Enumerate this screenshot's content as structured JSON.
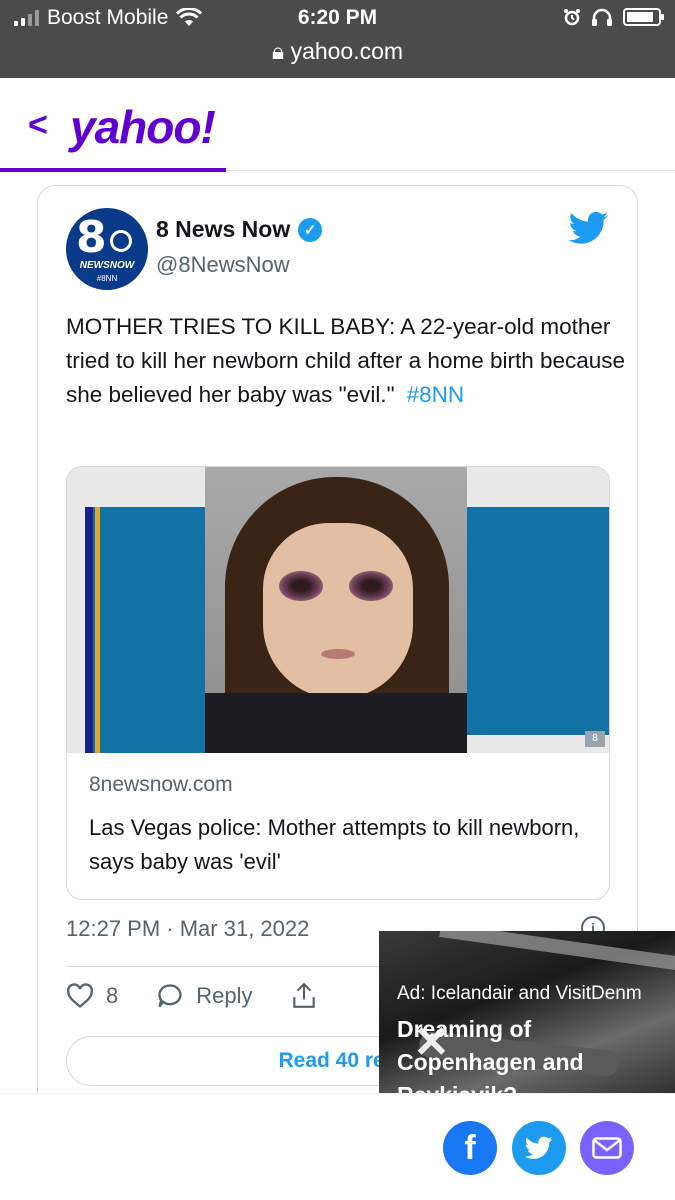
{
  "status_bar": {
    "carrier": "Boost Mobile",
    "time": "6:20 PM",
    "url": "yahoo.com"
  },
  "header": {
    "logo": "yahoo!",
    "back_icon": "chevron-left-icon",
    "accent_color": "#6001d2"
  },
  "tweet": {
    "display_name": "8 News Now",
    "handle": "@8NewsNow",
    "avatar": {
      "number": "8",
      "band": "NEWSNOW",
      "tag": "#8NN"
    },
    "text": "MOTHER TRIES TO KILL BABY: A 22-year-old mother tried to kill her newborn child after a home birth because she believed her baby was \"evil.\"",
    "hashtag": "#8NN",
    "link_card": {
      "domain": "8newsnow.com",
      "title": "Las Vegas police: Mother attempts to kill newborn, says baby was 'evil'",
      "logo_text": "8"
    },
    "timestamp": "12:27 PM · Mar 31, 2022",
    "likes": "8",
    "reply_label": "Reply",
    "read_replies_label": "Read 40 rep",
    "link_color": "#1d9bf0"
  },
  "ad": {
    "sponsor": "Ad: Icelandair and VisitDenm",
    "headline": "Dreaming of Copenhagen and Reykiavik?",
    "close_glyph": "✕"
  },
  "share": {
    "facebook_glyph": "f",
    "icons": [
      "facebook-icon",
      "twitter-icon",
      "mail-icon"
    ]
  }
}
